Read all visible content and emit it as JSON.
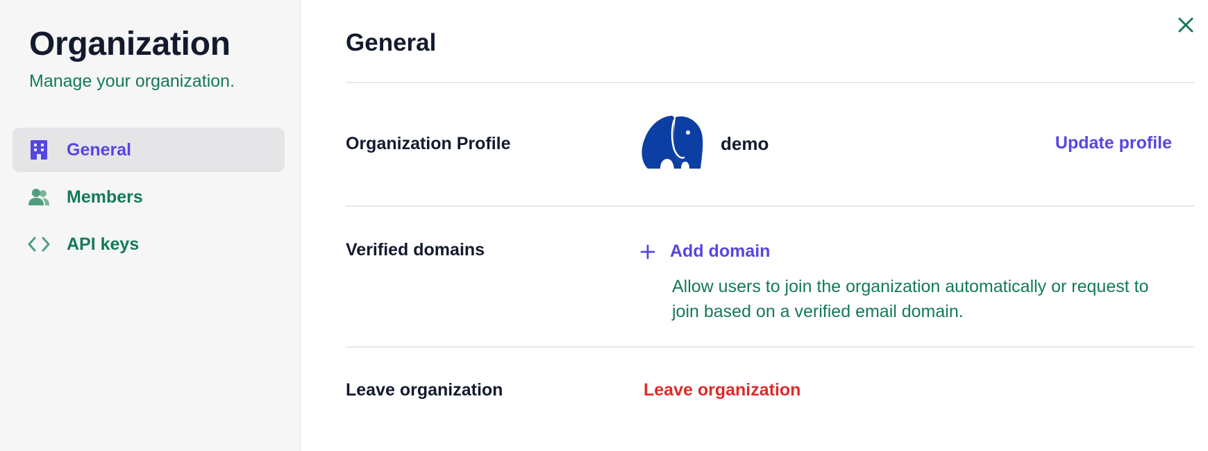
{
  "sidebar": {
    "title": "Organization",
    "subtitle": "Manage your organization.",
    "items": [
      {
        "label": "General",
        "icon": "building-icon",
        "active": true
      },
      {
        "label": "Members",
        "icon": "users-icon",
        "active": false
      },
      {
        "label": "API keys",
        "icon": "code-icon",
        "active": false
      }
    ]
  },
  "main": {
    "title": "General",
    "profile": {
      "label": "Organization Profile",
      "org_name": "demo",
      "avatar": "elephant-logo",
      "action": "Update profile"
    },
    "domains": {
      "label": "Verified domains",
      "action": "Add domain",
      "description": "Allow users to join the organization automatically or request to join based on a verified email domain."
    },
    "leave": {
      "label": "Leave organization",
      "action": "Leave organization"
    }
  },
  "colors": {
    "accent": "#5646e0",
    "text_green": "#137a55",
    "danger": "#dc2b2b",
    "heading": "#141a2e",
    "sidebar_bg": "#f6f6f7",
    "logo_blue": "#0c3fa3"
  }
}
